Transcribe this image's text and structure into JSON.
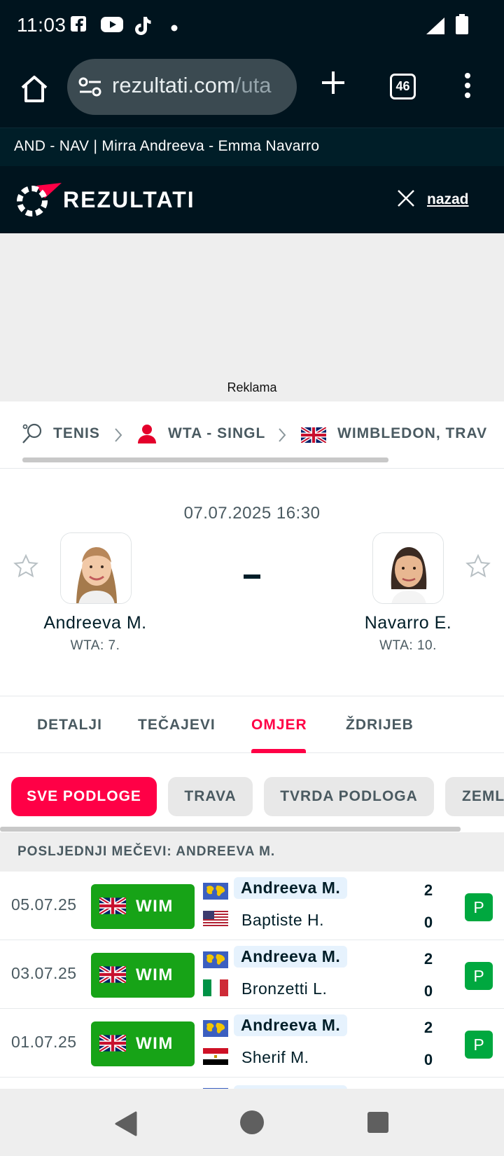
{
  "status_bar": {
    "time": "11:03",
    "icons": [
      "facebook-icon",
      "youtube-icon",
      "tiktok-icon",
      "dot-icon",
      "signal-icon",
      "battery-icon"
    ]
  },
  "browser": {
    "url_host": "rezultati.com",
    "url_path": "/uta",
    "tab_count": "46"
  },
  "page_title": "AND - NAV | Mirra Andreeva - Emma Navarro",
  "header": {
    "logo_text": "REZULTATI",
    "back_label": "nazad"
  },
  "ad": {
    "label": "Reklama"
  },
  "breadcrumb": {
    "items": [
      "TENIS",
      "WTA - SINGL",
      "WIMBLEDON, TRAV"
    ]
  },
  "match": {
    "datetime": "07.07.2025 16:30",
    "score_separator": "-",
    "home": {
      "name": "Andreeva M.",
      "rank": "WTA: 7."
    },
    "away": {
      "name": "Navarro E.",
      "rank": "WTA: 10."
    }
  },
  "tabs": {
    "items": [
      "DETALJI",
      "TEČAJEVI",
      "OMJER",
      "ŽDRIJEB"
    ],
    "active": "OMJER"
  },
  "filters": {
    "items": [
      "SVE PODLOGE",
      "TRAVA",
      "TVRDA PODLOGA",
      "ZEML"
    ],
    "active": "SVE PODLOGE"
  },
  "section": {
    "title": "POSLJEDNJI MEČEVI: ANDREEVA M."
  },
  "matches": [
    {
      "date": "05.07.25",
      "event": "WIM",
      "p1": "Andreeva M.",
      "p2": "Baptiste H.",
      "s1": "2",
      "s2": "0",
      "result": "P",
      "p2_flag": "usa-flag"
    },
    {
      "date": "03.07.25",
      "event": "WIM",
      "p1": "Andreeva M.",
      "p2": "Bronzetti L.",
      "s1": "2",
      "s2": "0",
      "result": "P",
      "p2_flag": "italy-flag"
    },
    {
      "date": "01.07.25",
      "event": "WIM",
      "p1": "Andreeva M.",
      "p2": "Sherif M.",
      "s1": "2",
      "s2": "0",
      "result": "P",
      "p2_flag": "egypt-flag"
    }
  ],
  "colors": {
    "brand_dark": "#00141e",
    "accent": "#ff0046",
    "event_green": "#17a317",
    "win_green": "#00a83f"
  }
}
